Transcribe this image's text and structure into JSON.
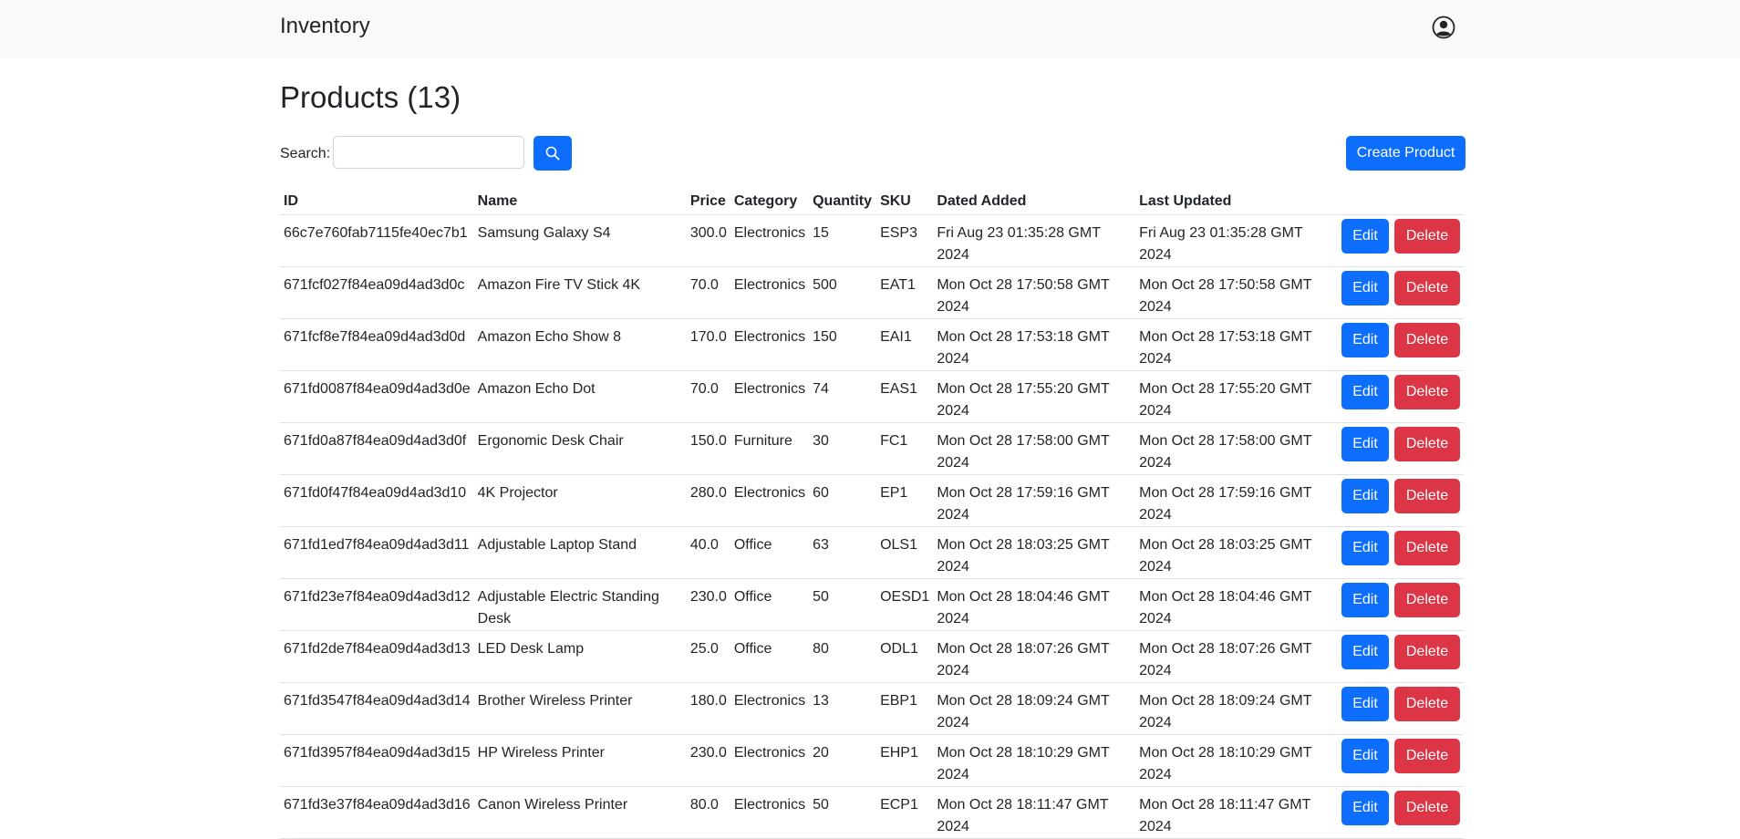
{
  "navbar": {
    "brand": "Inventory",
    "user_icon": "user-circle-icon"
  },
  "page": {
    "title": "Products (13)"
  },
  "search": {
    "label": "Search:",
    "value": "",
    "placeholder": "",
    "button_icon": "search-icon"
  },
  "actions": {
    "create_label": "Create Product",
    "edit_label": "Edit",
    "delete_label": "Delete"
  },
  "colors": {
    "primary": "#0d6efd",
    "danger": "#dc3545",
    "navbar_bg": "#f8f9fa"
  },
  "table": {
    "headers": [
      "ID",
      "Name",
      "Price",
      "Category",
      "Quantity",
      "SKU",
      "Dated Added",
      "Last Updated"
    ],
    "rows": [
      {
        "id": "66c7e760fab7115fe40ec7b1",
        "name": "Samsung Galaxy S4",
        "price": "300.0",
        "category": "Electronics",
        "quantity": "15",
        "sku": "ESP3",
        "added": "Fri Aug 23 01:35:28 GMT 2024",
        "updated": "Fri Aug 23 01:35:28 GMT 2024"
      },
      {
        "id": "671fcf027f84ea09d4ad3d0c",
        "name": "Amazon Fire TV Stick 4K",
        "price": "70.0",
        "category": "Electronics",
        "quantity": "500",
        "sku": "EAT1",
        "added": "Mon Oct 28 17:50:58 GMT 2024",
        "updated": "Mon Oct 28 17:50:58 GMT 2024"
      },
      {
        "id": "671fcf8e7f84ea09d4ad3d0d",
        "name": "Amazon Echo Show 8",
        "price": "170.0",
        "category": "Electronics",
        "quantity": "150",
        "sku": "EAI1",
        "added": "Mon Oct 28 17:53:18 GMT 2024",
        "updated": "Mon Oct 28 17:53:18 GMT 2024"
      },
      {
        "id": "671fd0087f84ea09d4ad3d0e",
        "name": "Amazon Echo Dot",
        "price": "70.0",
        "category": "Electronics",
        "quantity": "74",
        "sku": "EAS1",
        "added": "Mon Oct 28 17:55:20 GMT 2024",
        "updated": "Mon Oct 28 17:55:20 GMT 2024"
      },
      {
        "id": "671fd0a87f84ea09d4ad3d0f",
        "name": "Ergonomic Desk Chair",
        "price": "150.0",
        "category": "Furniture",
        "quantity": "30",
        "sku": "FC1",
        "added": "Mon Oct 28 17:58:00 GMT 2024",
        "updated": "Mon Oct 28 17:58:00 GMT 2024"
      },
      {
        "id": "671fd0f47f84ea09d4ad3d10",
        "name": "4K Projector",
        "price": "280.0",
        "category": "Electronics",
        "quantity": "60",
        "sku": "EP1",
        "added": "Mon Oct 28 17:59:16 GMT 2024",
        "updated": "Mon Oct 28 17:59:16 GMT 2024"
      },
      {
        "id": "671fd1ed7f84ea09d4ad3d11",
        "name": "Adjustable Laptop Stand",
        "price": "40.0",
        "category": "Office",
        "quantity": "63",
        "sku": "OLS1",
        "added": "Mon Oct 28 18:03:25 GMT 2024",
        "updated": "Mon Oct 28 18:03:25 GMT 2024"
      },
      {
        "id": "671fd23e7f84ea09d4ad3d12",
        "name": "Adjustable Electric Standing Desk",
        "price": "230.0",
        "category": "Office",
        "quantity": "50",
        "sku": "OESD1",
        "added": "Mon Oct 28 18:04:46 GMT 2024",
        "updated": "Mon Oct 28 18:04:46 GMT 2024"
      },
      {
        "id": "671fd2de7f84ea09d4ad3d13",
        "name": "LED Desk Lamp",
        "price": "25.0",
        "category": "Office",
        "quantity": "80",
        "sku": "ODL1",
        "added": "Mon Oct 28 18:07:26 GMT 2024",
        "updated": "Mon Oct 28 18:07:26 GMT 2024"
      },
      {
        "id": "671fd3547f84ea09d4ad3d14",
        "name": "Brother Wireless Printer",
        "price": "180.0",
        "category": "Electronics",
        "quantity": "13",
        "sku": "EBP1",
        "added": "Mon Oct 28 18:09:24 GMT 2024",
        "updated": "Mon Oct 28 18:09:24 GMT 2024"
      },
      {
        "id": "671fd3957f84ea09d4ad3d15",
        "name": "HP Wireless Printer",
        "price": "230.0",
        "category": "Electronics",
        "quantity": "20",
        "sku": "EHP1",
        "added": "Mon Oct 28 18:10:29 GMT 2024",
        "updated": "Mon Oct 28 18:10:29 GMT 2024"
      },
      {
        "id": "671fd3e37f84ea09d4ad3d16",
        "name": "Canon Wireless Printer",
        "price": "80.0",
        "category": "Electronics",
        "quantity": "50",
        "sku": "ECP1",
        "added": "Mon Oct 28 18:11:47 GMT 2024",
        "updated": "Mon Oct 28 18:11:47 GMT 2024"
      }
    ]
  }
}
